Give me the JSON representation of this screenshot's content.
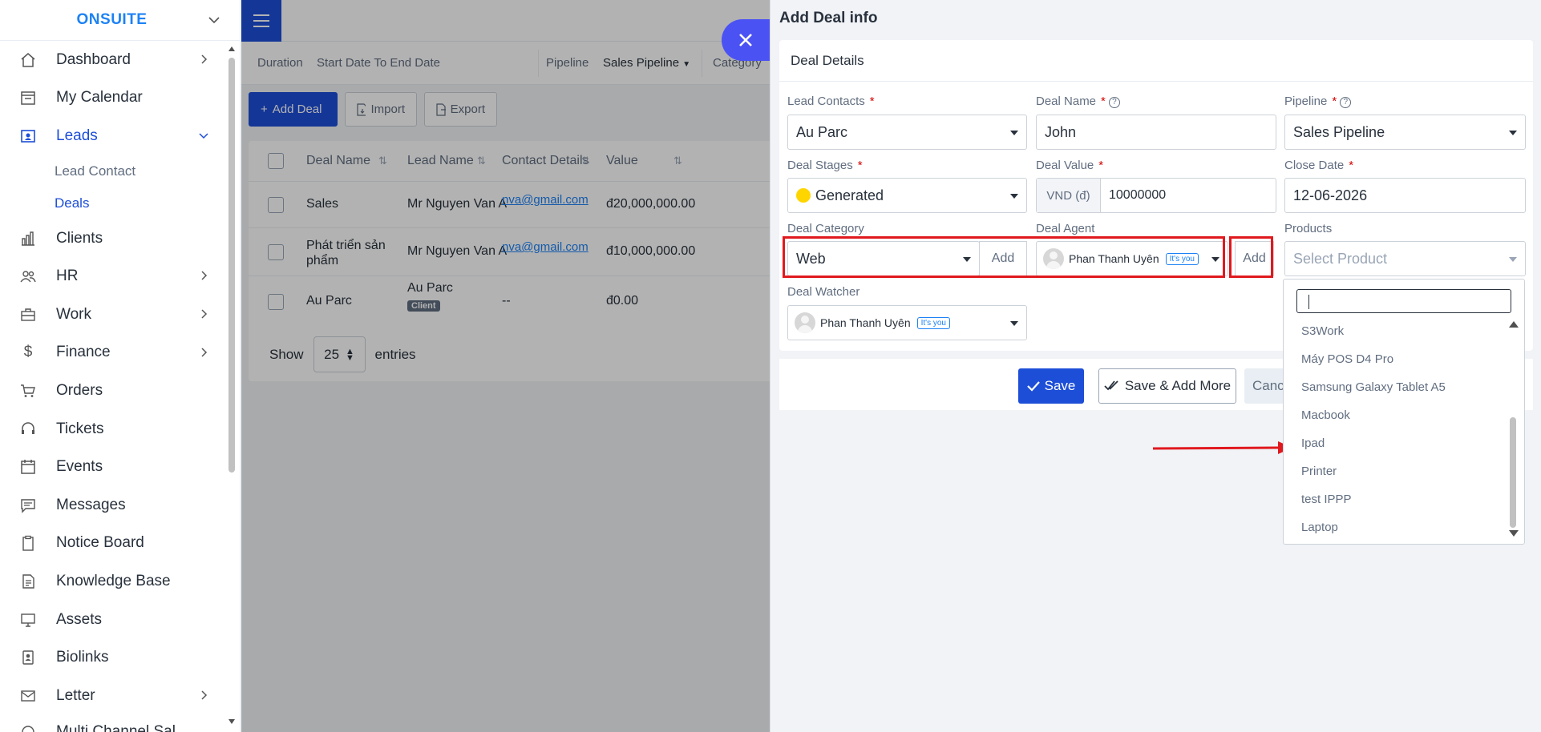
{
  "brand": {
    "name": "ONSUITE"
  },
  "sidebar": {
    "items": [
      {
        "label": "Dashboard",
        "icon": "home-icon",
        "chevron": true
      },
      {
        "label": "My Calendar",
        "icon": "calendar-icon",
        "chevron": false
      },
      {
        "label": "Leads",
        "icon": "leads-icon",
        "chevron": true,
        "active": true,
        "children": [
          {
            "label": "Lead Contact"
          },
          {
            "label": "Deals",
            "active": true
          }
        ]
      },
      {
        "label": "Clients",
        "icon": "chart-icon",
        "chevron": false
      },
      {
        "label": "HR",
        "icon": "people-icon",
        "chevron": true
      },
      {
        "label": "Work",
        "icon": "briefcase-icon",
        "chevron": true
      },
      {
        "label": "Finance",
        "icon": "dollar-icon",
        "chevron": true
      },
      {
        "label": "Orders",
        "icon": "cart-icon",
        "chevron": false
      },
      {
        "label": "Tickets",
        "icon": "headset-icon",
        "chevron": false
      },
      {
        "label": "Events",
        "icon": "event-icon",
        "chevron": false
      },
      {
        "label": "Messages",
        "icon": "message-icon",
        "chevron": false
      },
      {
        "label": "Notice Board",
        "icon": "clipboard-icon",
        "chevron": false
      },
      {
        "label": "Knowledge Base",
        "icon": "book-icon",
        "chevron": false
      },
      {
        "label": "Assets",
        "icon": "monitor-icon",
        "chevron": false
      },
      {
        "label": "Biolinks",
        "icon": "profile-icon",
        "chevron": false
      },
      {
        "label": "Letter",
        "icon": "mail-icon",
        "chevron": true
      },
      {
        "label": "Multi Channel Sal",
        "icon": "channel-icon",
        "chevron": false
      }
    ]
  },
  "filters": {
    "duration_label": "Duration",
    "duration_value": "Start Date To End Date",
    "pipeline_label": "Pipeline",
    "pipeline_value": "Sales Pipeline",
    "category_label": "Category"
  },
  "actions": {
    "add": "Add Deal",
    "import": "Import",
    "export": "Export"
  },
  "table": {
    "headers": [
      "Deal Name",
      "Lead Name",
      "Contact Details",
      "Value"
    ],
    "rows": [
      {
        "deal": "Sales",
        "lead": "Mr Nguyen Van A",
        "contact": "nva@gmail.com",
        "value": "đ20,000,000.00"
      },
      {
        "deal": "Phát triển sản phẩm",
        "lead": "Mr Nguyen Van A",
        "contact": "nva@gmail.com",
        "value": "đ10,000,000.00"
      },
      {
        "deal": "Au Parc",
        "lead": "Au Parc",
        "lead_tag": "Client",
        "contact": "--",
        "value": "đ0.00"
      }
    ],
    "show_label": "Show",
    "page_size": "25",
    "entries_label": "entries"
  },
  "panel": {
    "title": "Add Deal info",
    "section": "Deal Details",
    "fields": {
      "lead_contacts": {
        "label": "Lead Contacts",
        "value": "Au Parc"
      },
      "deal_name": {
        "label": "Deal Name",
        "value": "John"
      },
      "pipeline": {
        "label": "Pipeline",
        "value": "Sales Pipeline"
      },
      "deal_stages": {
        "label": "Deal Stages",
        "value": "Generated",
        "dot_color": "#ffd500"
      },
      "deal_value": {
        "label": "Deal Value",
        "prefix": "VND (đ)",
        "value": "10000000"
      },
      "close_date": {
        "label": "Close Date",
        "value": "12-06-2026"
      },
      "deal_category": {
        "label": "Deal Category",
        "value": "Web",
        "add": "Add"
      },
      "deal_agent": {
        "label": "Deal Agent",
        "value": "Phan Thanh Uyên",
        "badge": "It's you",
        "add": "Add"
      },
      "products": {
        "label": "Products",
        "placeholder": "Select Product"
      },
      "deal_watcher": {
        "label": "Deal Watcher",
        "value": "Phan Thanh Uyên",
        "badge": "It's you"
      }
    },
    "buttons": {
      "save": "Save",
      "save_more": "Save & Add More",
      "cancel": "Cancel"
    }
  },
  "products_dropdown": {
    "search_value": "",
    "options": [
      "S3Work",
      "Máy POS D4 Pro",
      "Samsung Galaxy Tablet A5",
      "Macbook",
      "Ipad",
      "Printer",
      "test IPPP",
      "Laptop"
    ]
  },
  "colors": {
    "accent": "#1d4ed8",
    "annotation": "#e0191e",
    "brand": "#1d82f5"
  }
}
